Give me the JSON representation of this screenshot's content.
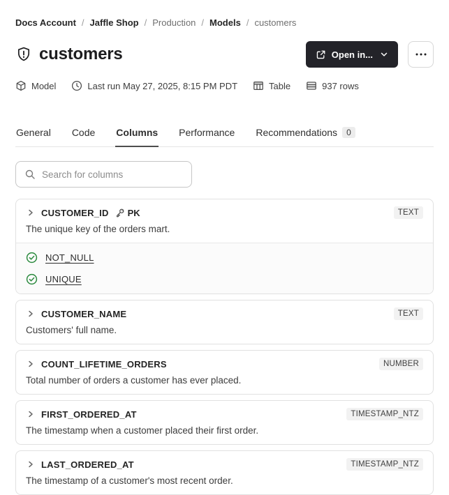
{
  "breadcrumb": {
    "separator": "/",
    "items": [
      {
        "label": "Docs Account",
        "bold": true
      },
      {
        "label": "Jaffle Shop",
        "bold": true
      },
      {
        "label": "Production",
        "bold": false
      },
      {
        "label": "Models",
        "bold": true
      },
      {
        "label": "customers",
        "bold": false
      }
    ]
  },
  "header": {
    "title": "customers",
    "title_icon": "shield-alert-icon",
    "open_in_label": "Open in...",
    "more_button_icon": "ellipsis-icon"
  },
  "meta": {
    "items": [
      {
        "icon": "cube-icon",
        "label": "Model"
      },
      {
        "icon": "clock-icon",
        "label": "Last run May 27, 2025, 8:15 PM PDT"
      },
      {
        "icon": "table-icon",
        "label": "Table"
      },
      {
        "icon": "rows-icon",
        "label": "937 rows"
      }
    ]
  },
  "tabs": [
    {
      "label": "General",
      "active": false
    },
    {
      "label": "Code",
      "active": false
    },
    {
      "label": "Columns",
      "active": true
    },
    {
      "label": "Performance",
      "active": false
    },
    {
      "label": "Recommendations",
      "active": false,
      "badge": "0"
    }
  ],
  "search": {
    "placeholder": "Search for columns"
  },
  "columns": [
    {
      "name": "CUSTOMER_ID",
      "pk": "PK",
      "type": "TEXT",
      "description": "The unique key of the orders mart.",
      "tests": [
        "NOT_NULL",
        "UNIQUE"
      ]
    },
    {
      "name": "CUSTOMER_NAME",
      "type": "TEXT",
      "description": "Customers' full name.",
      "tests": []
    },
    {
      "name": "COUNT_LIFETIME_ORDERS",
      "type": "NUMBER",
      "description": "Total number of orders a customer has ever placed.",
      "tests": []
    },
    {
      "name": "FIRST_ORDERED_AT",
      "type": "TIMESTAMP_NTZ",
      "description": "The timestamp when a customer placed their first order.",
      "tests": []
    },
    {
      "name": "LAST_ORDERED_AT",
      "type": "TIMESTAMP_NTZ",
      "description": "The timestamp of a customer's most recent order.",
      "tests": []
    }
  ]
}
